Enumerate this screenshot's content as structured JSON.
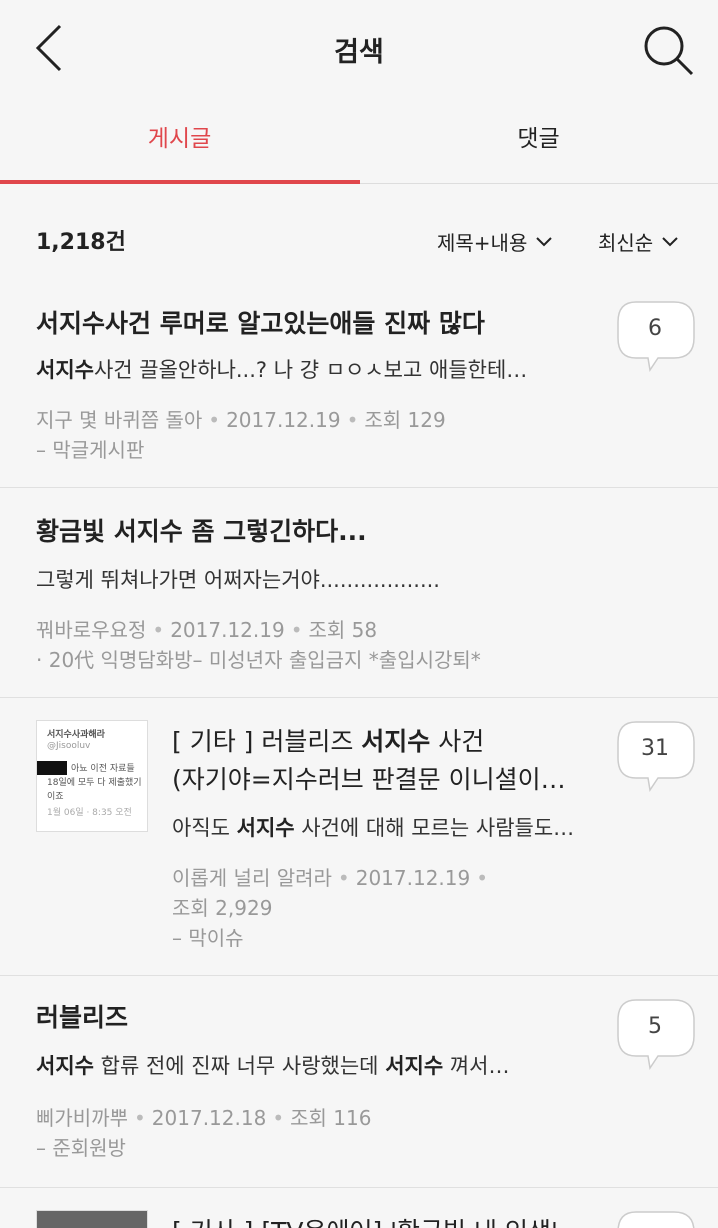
{
  "header": {
    "title": "검색"
  },
  "tabs": [
    {
      "label": "게시글",
      "active": true
    },
    {
      "label": "댓글",
      "active": false
    }
  ],
  "summary": {
    "count": "1,218건",
    "scope_filter": "제목+내용",
    "sort": "최신순"
  },
  "colors": {
    "accent": "#e0474c",
    "background": "#f6f6f6"
  },
  "posts": [
    {
      "title_hl": "서지수",
      "title_rest": "사건 루머로 알고있는애들 진짜 많다",
      "snippet_hl": "서지수",
      "snippet_rest": "사건 끌올안하나...? 나 걍 ㅁㅇㅅ보고 애들한테…",
      "author": "지구 몇 바퀴쯤 돌아",
      "date": "2017.12.19",
      "views": "조회 129",
      "board": "–  막글게시판",
      "comments": "6"
    },
    {
      "title_pre": "황금빛 ",
      "title_hl": "서지수",
      "title_rest": " 좀 그렇긴하다...",
      "snippet": "그렇게 뛰쳐나가면 어쩌자는거야..................",
      "author": "꿔바로우요정",
      "date": "2017.12.19",
      "views": "조회 58",
      "board": "·  20代 익명담화방– 미성년자 출입금지 *출입시강퇴*"
    },
    {
      "title_pre": "[ 기타 ] 러블리즈 ",
      "title_hl": "서지수",
      "title_rest": " 사건",
      "title_line2": "(자기야=지수러브 판결문 이니셜이…",
      "snippet_pre": "아직도 ",
      "snippet_hl": "서지수",
      "snippet_rest": " 사건에 대해 모르는 사람들도…",
      "author": "이롭게 널리 알려라",
      "date": "2017.12.19",
      "views": "조회 2,929",
      "board": "–  막이슈",
      "comments": "31",
      "thumb": {
        "line1": "서지수사과해라",
        "line2": "@Jisooluv",
        "line3": "아뇨 이전 자료들",
        "line4": "18일에 모두 다 제출했기",
        "line5": "이죠",
        "line6": "1월 06일 · 8:35 오전"
      }
    },
    {
      "title": "러블리즈",
      "snippet_hl": "서지수",
      "snippet_mid": " 합류 전에 진짜 너무 사랑했는데 ",
      "snippet_hl2": "서지수",
      "snippet_rest": " 껴서…",
      "author": "삐가비까뿌",
      "date": "2017.12.18",
      "views": "조회 116",
      "board": "–  준회원방",
      "comments": "5"
    },
    {
      "title_partial": "[ 기사 ] [TV온에어] '황금빛 내 인생'"
    }
  ]
}
